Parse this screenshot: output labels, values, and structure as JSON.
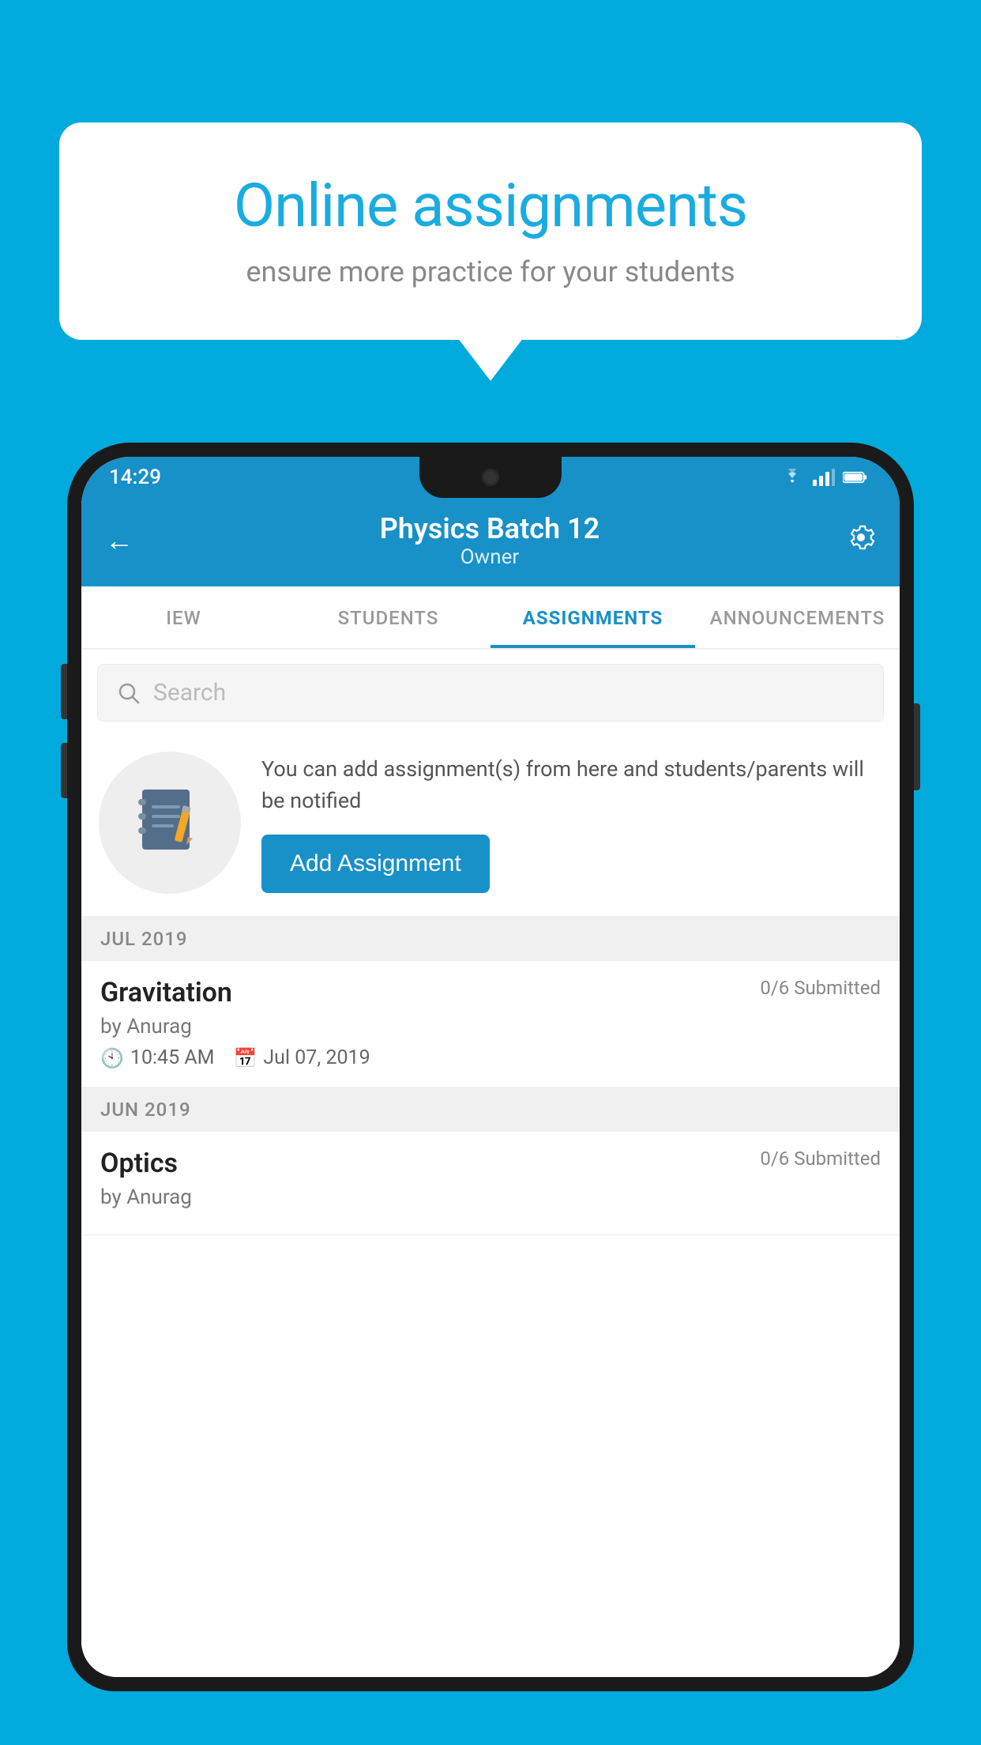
{
  "background_color": "#00AADD",
  "speech_bubble": {
    "title": "Online assignments",
    "subtitle": "ensure more practice for your students"
  },
  "phone": {
    "status_bar": {
      "time": "14:29"
    },
    "header": {
      "title": "Physics Batch 12",
      "subtitle": "Owner",
      "back_label": "←",
      "settings_label": "⚙"
    },
    "tabs": [
      {
        "label": "IEW",
        "active": false
      },
      {
        "label": "STUDENTS",
        "active": false
      },
      {
        "label": "ASSIGNMENTS",
        "active": true
      },
      {
        "label": "ANNOUNCEMENTS",
        "active": false
      }
    ],
    "search": {
      "placeholder": "Search"
    },
    "promo": {
      "description": "You can add assignment(s) from here and students/parents will be notified",
      "button_label": "Add Assignment"
    },
    "sections": [
      {
        "month": "JUL 2019",
        "assignments": [
          {
            "title": "Gravitation",
            "submitted": "0/6 Submitted",
            "by": "by Anurag",
            "time": "10:45 AM",
            "date": "Jul 07, 2019"
          }
        ]
      },
      {
        "month": "JUN 2019",
        "assignments": [
          {
            "title": "Optics",
            "submitted": "0/6 Submitted",
            "by": "by Anurag",
            "time": "",
            "date": ""
          }
        ]
      }
    ]
  }
}
